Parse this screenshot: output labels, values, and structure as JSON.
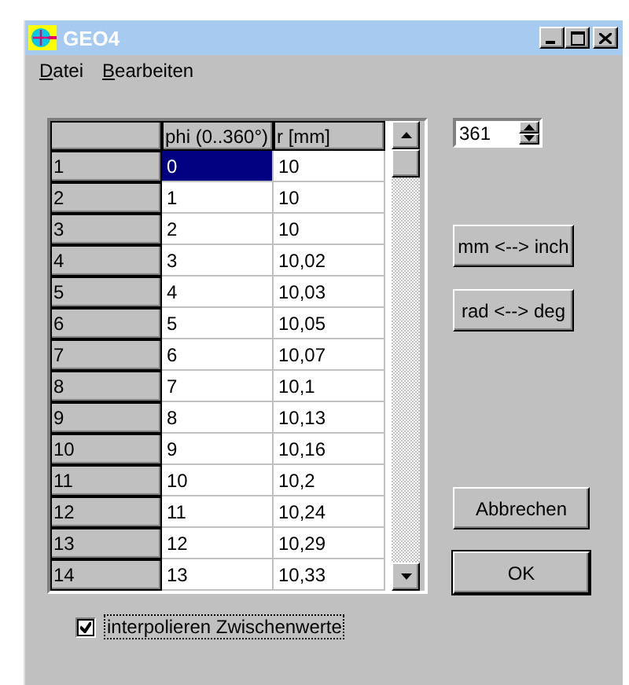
{
  "window": {
    "title": "GEO4"
  },
  "menu": [
    {
      "label": "Datei"
    },
    {
      "label": "Bearbeiten"
    }
  ],
  "table": {
    "columns": [
      "phi (0..360°)",
      "r [mm]"
    ],
    "rows": [
      {
        "header": "1",
        "phi": "0",
        "r": "10",
        "selected": true
      },
      {
        "header": "2",
        "phi": "1",
        "r": "10",
        "selected": false
      },
      {
        "header": "3",
        "phi": "2",
        "r": "10",
        "selected": false
      },
      {
        "header": "4",
        "phi": "3",
        "r": "10,02",
        "selected": false
      },
      {
        "header": "5",
        "phi": "4",
        "r": "10,03",
        "selected": false
      },
      {
        "header": "6",
        "phi": "5",
        "r": "10,05",
        "selected": false
      },
      {
        "header": "7",
        "phi": "6",
        "r": "10,07",
        "selected": false
      },
      {
        "header": "8",
        "phi": "7",
        "r": "10,1",
        "selected": false
      },
      {
        "header": "9",
        "phi": "8",
        "r": "10,13",
        "selected": false
      },
      {
        "header": "10",
        "phi": "9",
        "r": "10,16",
        "selected": false
      },
      {
        "header": "11",
        "phi": "10",
        "r": "10,2",
        "selected": false
      },
      {
        "header": "12",
        "phi": "11",
        "r": "10,24",
        "selected": false
      },
      {
        "header": "13",
        "phi": "12",
        "r": "10,29",
        "selected": false
      },
      {
        "header": "14",
        "phi": "13",
        "r": "10,33",
        "selected": false
      }
    ]
  },
  "spinner": {
    "value": "361"
  },
  "buttons": [
    {
      "label": "mm <--> inch",
      "kind": "plain"
    },
    {
      "label": "rad <--> deg",
      "kind": "plain"
    },
    {
      "label": "Abbrechen",
      "kind": "plain"
    },
    {
      "label": "OK",
      "kind": "default"
    }
  ],
  "checkbox": {
    "label": "interpolieren Zwischenwerte",
    "checked": true,
    "focused": true
  }
}
